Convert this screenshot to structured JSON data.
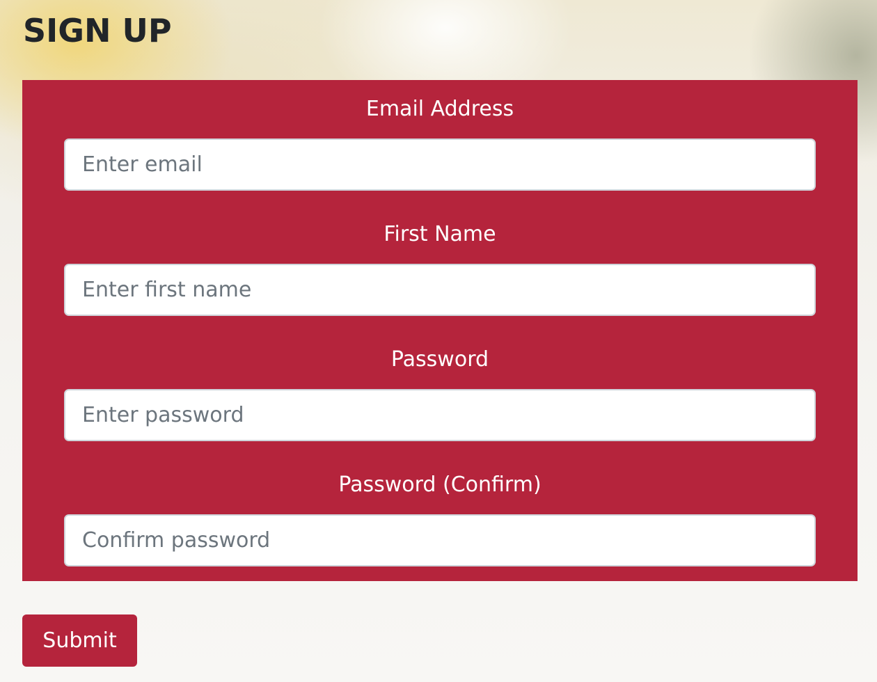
{
  "page": {
    "title": "SIGN UP"
  },
  "form": {
    "fields": [
      {
        "label": "Email Address",
        "placeholder": "Enter email",
        "value": ""
      },
      {
        "label": "First Name",
        "placeholder": "Enter first name",
        "value": ""
      },
      {
        "label": "Password",
        "placeholder": "Enter password",
        "value": ""
      },
      {
        "label": "Password (Confirm)",
        "placeholder": "Confirm password",
        "value": ""
      }
    ],
    "submit_label": "Submit"
  },
  "colors": {
    "accent": "#b5243c",
    "title": "#212529",
    "label": "#ffffff",
    "placeholder": "#6c757d"
  }
}
